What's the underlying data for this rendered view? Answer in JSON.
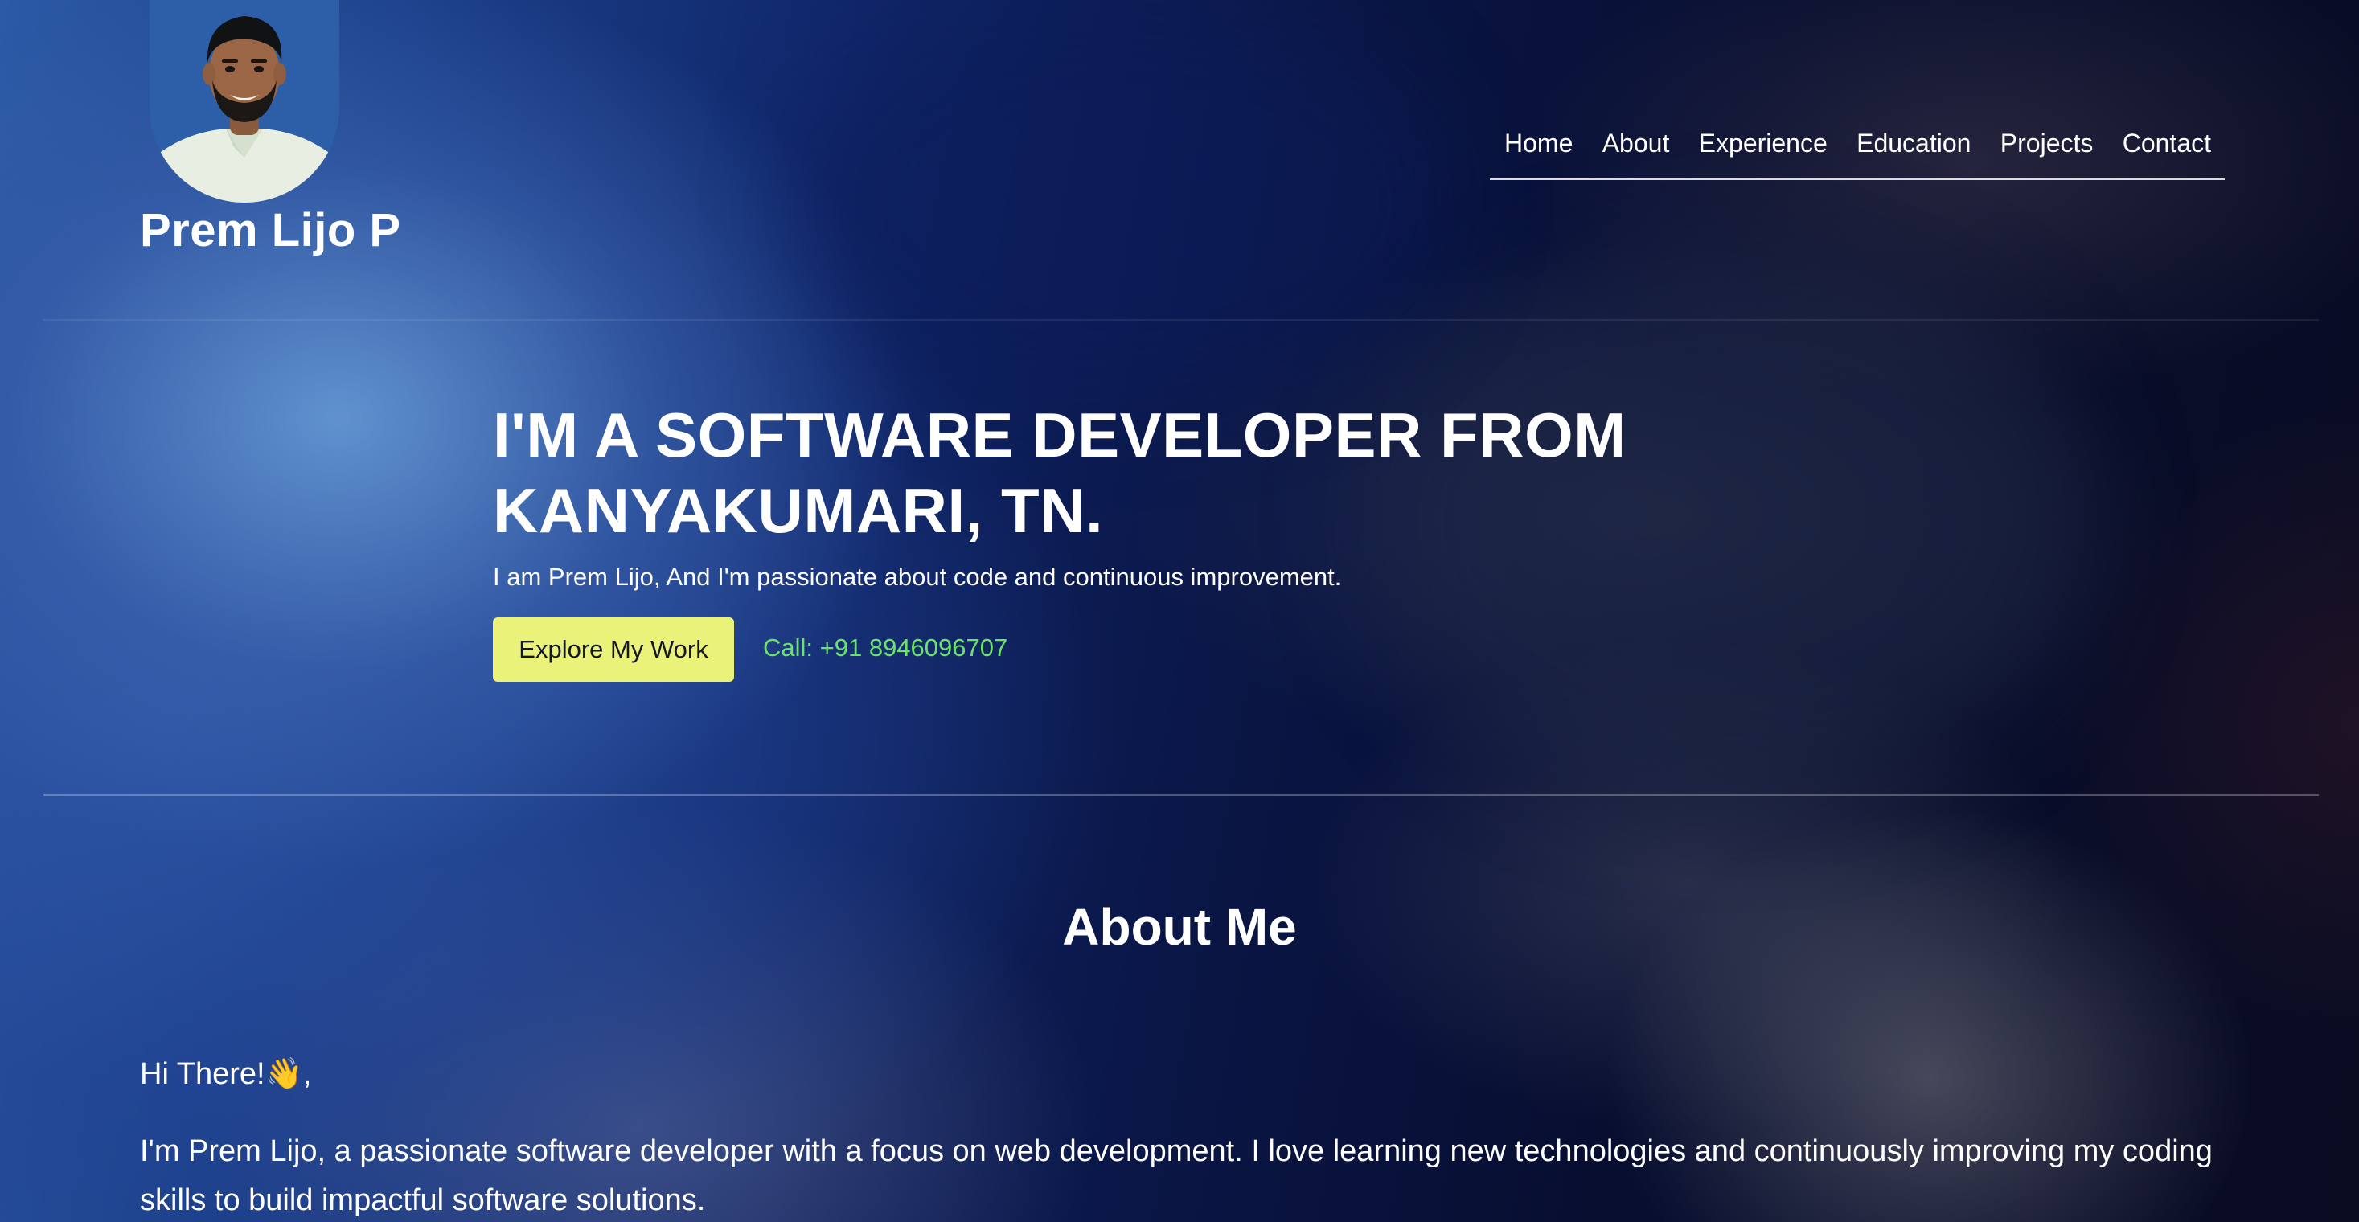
{
  "header": {
    "brand_name": "Prem Lijo P",
    "nav": [
      {
        "label": "Home"
      },
      {
        "label": "About"
      },
      {
        "label": "Experience"
      },
      {
        "label": "Education"
      },
      {
        "label": "Projects"
      },
      {
        "label": "Contact"
      }
    ]
  },
  "hero": {
    "title_line1": "I'M A SOFTWARE DEVELOPER FROM",
    "title_line2": "KANYAKUMARI, TN.",
    "subtitle": "I am Prem Lijo, And I'm passionate about code and continuous improvement.",
    "explore_button": "Explore My Work",
    "call_text": "Call: +91 8946096707"
  },
  "about": {
    "heading": "About Me",
    "greeting": "Hi There!👋,",
    "paragraph": "I'm Prem Lijo, a passionate software developer with a focus on web development. I love learning new technologies and continuously improving my coding skills to build impactful software solutions."
  },
  "colors": {
    "accent_button": "#ebf27a",
    "call_link": "#6be36a",
    "background_dark": "#070d2e",
    "background_blue": "#2c5aa6"
  },
  "icons": {
    "avatar": "profile-photo"
  }
}
